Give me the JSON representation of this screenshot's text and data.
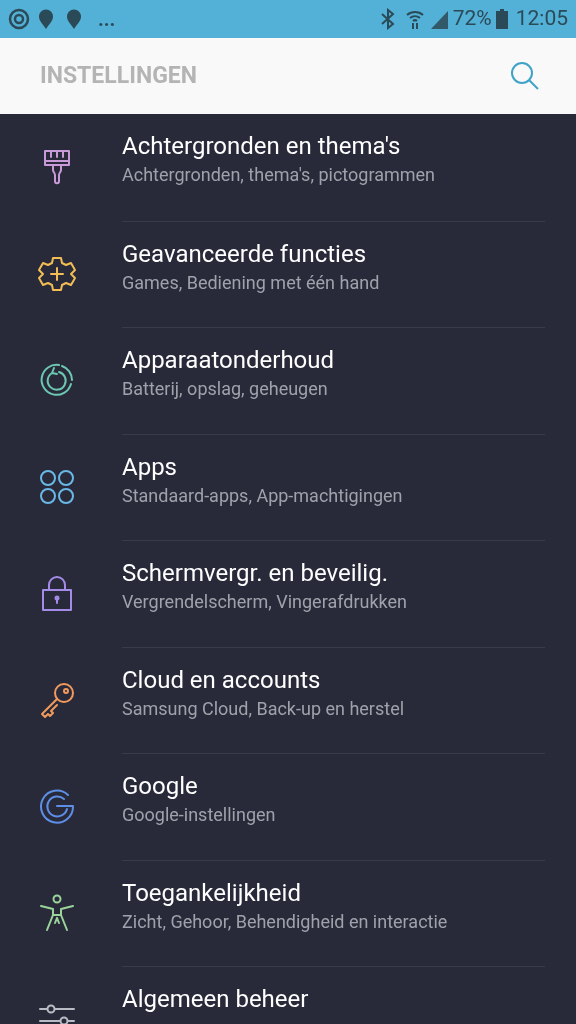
{
  "status_bar": {
    "notification_overflow": "...",
    "battery": "72%",
    "time": "12:05"
  },
  "header": {
    "title": "INSTELLINGEN"
  },
  "items": [
    {
      "kind": "brush",
      "color": "#c89ad8",
      "title": "Achtergronden en thema's",
      "subtitle": "Achtergronden, thema's, pictogrammen"
    },
    {
      "kind": "gear",
      "color": "#f2bd55",
      "title": "Geavanceerde functies",
      "subtitle": "Games, Bediening met één hand"
    },
    {
      "kind": "refresh",
      "color": "#6cc8b0",
      "title": "Apparaatonderhoud",
      "subtitle": "Batterij, opslag, geheugen"
    },
    {
      "kind": "apps",
      "color": "#6ab8e6",
      "title": "Apps",
      "subtitle": "Standaard-apps, App-machtigingen"
    },
    {
      "kind": "lock",
      "color": "#a58be8",
      "title": "Schermvergr. en beveilig.",
      "subtitle": "Vergrendelscherm, Vingerafdrukken"
    },
    {
      "kind": "key",
      "color": "#f29a5e",
      "title": "Cloud en accounts",
      "subtitle": "Samsung Cloud, Back-up en herstel"
    },
    {
      "kind": "google",
      "color": "#5d8fe6",
      "title": "Google",
      "subtitle": "Google-instellingen"
    },
    {
      "kind": "person",
      "color": "#9ad49a",
      "title": "Toegankelijkheid",
      "subtitle": "Zicht, Gehoor, Behendigheid en interactie"
    },
    {
      "kind": "sliders",
      "color": "#b8bcc4",
      "title": "Algemeen beheer"
    }
  ]
}
